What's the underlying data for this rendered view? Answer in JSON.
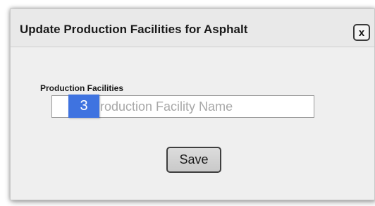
{
  "dialog": {
    "title": "Update Production Facilities for Asphalt",
    "close_label": "x"
  },
  "form": {
    "facilities_label": "Production Facilities",
    "facility_placeholder": "Production Facility Name",
    "step_badge": "3"
  },
  "actions": {
    "save_label": "Save"
  },
  "colors": {
    "badge": "#3f73e0",
    "dialog_background": "#efefef"
  }
}
